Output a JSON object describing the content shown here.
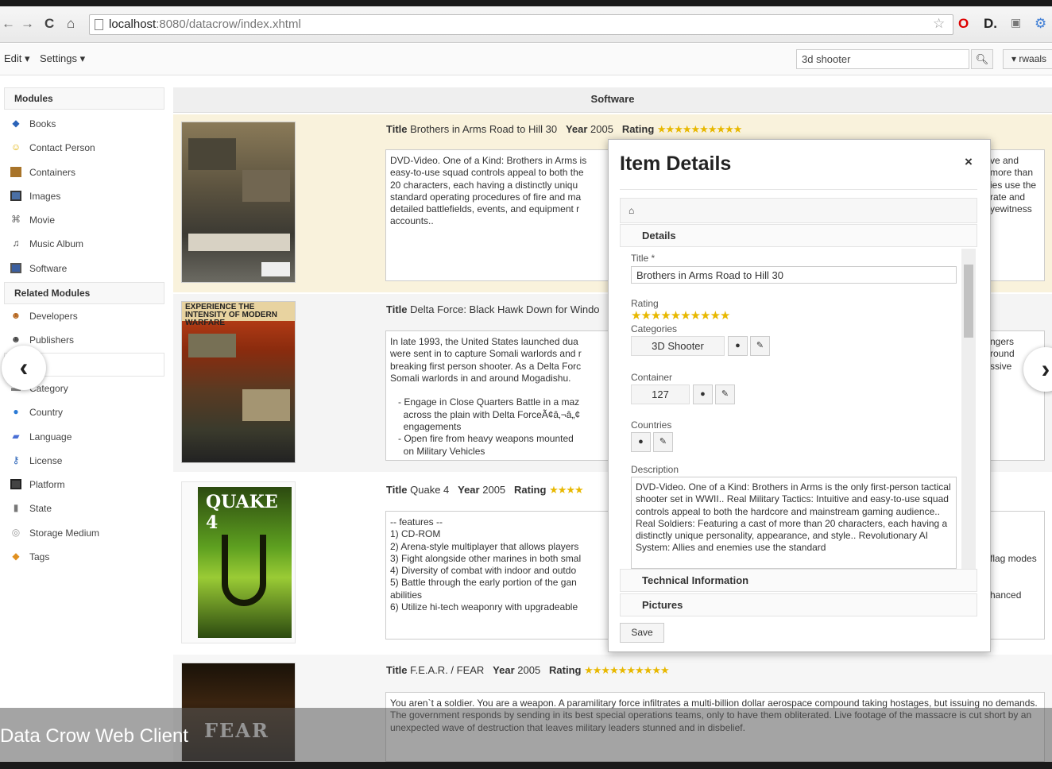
{
  "browser": {
    "url_host": "localhost",
    "url_path": ":8080/datacrow/index.xhtml",
    "back_glyph": "←",
    "forward_glyph": "→",
    "reload_glyph": "C",
    "home_glyph": "⌂"
  },
  "menubar": {
    "edit_label": "Edit ▾",
    "settings_label": "Settings ▾",
    "search_value": "3d shooter",
    "user_label": "▾ rwaals"
  },
  "sidebar": {
    "modules_heading": "Modules",
    "modules": [
      {
        "label": "Books",
        "icon": "book-icon"
      },
      {
        "label": "Contact Person",
        "icon": "smiley-icon"
      },
      {
        "label": "Containers",
        "icon": "box-icon"
      },
      {
        "label": "Images",
        "icon": "image-icon"
      },
      {
        "label": "Movie",
        "icon": "film-icon"
      },
      {
        "label": "Music Album",
        "icon": "music-icon"
      },
      {
        "label": "Software",
        "icon": "monitor-icon"
      }
    ],
    "related_heading": "Related Modules",
    "related": [
      {
        "label": "Developers",
        "icon": "person-icon"
      },
      {
        "label": "Publishers",
        "icon": "person-icon"
      },
      {
        "label": "",
        "icon": ""
      },
      {
        "label": "Category",
        "icon": "folder-icon"
      },
      {
        "label": "Country",
        "icon": "globe-icon"
      },
      {
        "label": "Language",
        "icon": "speech-icon"
      },
      {
        "label": "License",
        "icon": "key-icon"
      },
      {
        "label": "Platform",
        "icon": "console-icon"
      },
      {
        "label": "State",
        "icon": "cylinder-icon"
      },
      {
        "label": "Storage Medium",
        "icon": "disc-icon"
      },
      {
        "label": "Tags",
        "icon": "tag-icon"
      }
    ]
  },
  "main": {
    "heading": "Software",
    "items": [
      {
        "title_key": "Title",
        "title": "Brothers in Arms Road to Hill 30",
        "year_key": "Year",
        "year": "2005",
        "rating_key": "Rating",
        "rating": 10,
        "description": "DVD-Video. One of a Kind: Brothers in Arms is\neasy-to-use squad controls appeal to both the\n20 characters, each having a distinctly uniqu\nstandard operating procedures of fire and ma\ndetailed battlefields, events, and equipment r\naccounts..",
        "description_right": "ve and\nmore than\nies use the\nrate and\nyewitness"
      },
      {
        "title_key": "Title",
        "title": "Delta Force: Black Hawk Down for Windo",
        "description": "In late 1993, the United States launched dua\nwere sent in to capture Somali warlords and r\nbreaking first person shooter. As a Delta Forc\nSomali warlords in and around Mogadishu.\n\n   - Engage in Close Quarters Battle in a maz\n     across the plain with Delta ForceÃ¢â‚¬â„¢\n     engagements\n   - Open fire from heavy weapons mounted\n     on Military Vehicles",
        "description_right": "ngers\nround\nssive"
      },
      {
        "title_key": "Title",
        "title": "Quake 4",
        "year_key": "Year",
        "year": "2005",
        "rating_key": "Rating",
        "rating": 4,
        "description": "-- features --\n1) CD-ROM\n2) Arena-style multiplayer that allows players\n3) Fight alongside other marines in both smal\n4) Diversity of combat with indoor and outdo\n5) Battle through the early portion of the gan\nabilities\n6) Utilize hi-tech weaponry with upgradeable",
        "description_right": "\n\n\nflag modes\n\n\nhanced"
      },
      {
        "title_key": "Title",
        "title": "F.E.A.R. / FEAR",
        "year_key": "Year",
        "year": "2005",
        "rating_key": "Rating",
        "rating": 10,
        "description": "You aren`t a soldier. You are a weapon. A paramilitary force infiltrates a multi-billion dollar aerospace compound taking hostages, but issuing no demands. The government responds by sending in its best special operations teams, only to have them obliterated. Live footage of the massacre is cut short by an unexpected wave of destruction that leaves military leaders stunned and in disbelief."
      }
    ]
  },
  "dialog": {
    "title": "Item Details",
    "close_glyph": "×",
    "home_glyph": "⌂",
    "details_label": "Details",
    "title_label": "Title *",
    "title_value": "Brothers in Arms Road to Hill 30",
    "rating_label": "Rating",
    "rating": 10,
    "categories_label": "Categories",
    "category_value": "3D Shooter",
    "container_label": "Container",
    "container_value": "127",
    "countries_label": "Countries",
    "description_label": "Description",
    "description_value": "DVD-Video. One of a Kind: Brothers in Arms is the only first-person tactical shooter set in WWII.. Real Military Tactics: Intuitive and easy-to-use squad controls appeal to both the hardcore and mainstream gaming audience.. Real Soldiers: Featuring a cast of more than 20 characters, each having a distinctly unique personality, appearance, and style.. Revolutionary AI System: Allies and enemies use the standard",
    "technical_label": "Technical Information",
    "pictures_label": "Pictures",
    "save_label": "Save"
  },
  "caption": "Data Crow Web Client",
  "colors": {
    "star": "#e8b800",
    "selected_row": "#f9f2dc",
    "accent": "#2a63b8"
  }
}
